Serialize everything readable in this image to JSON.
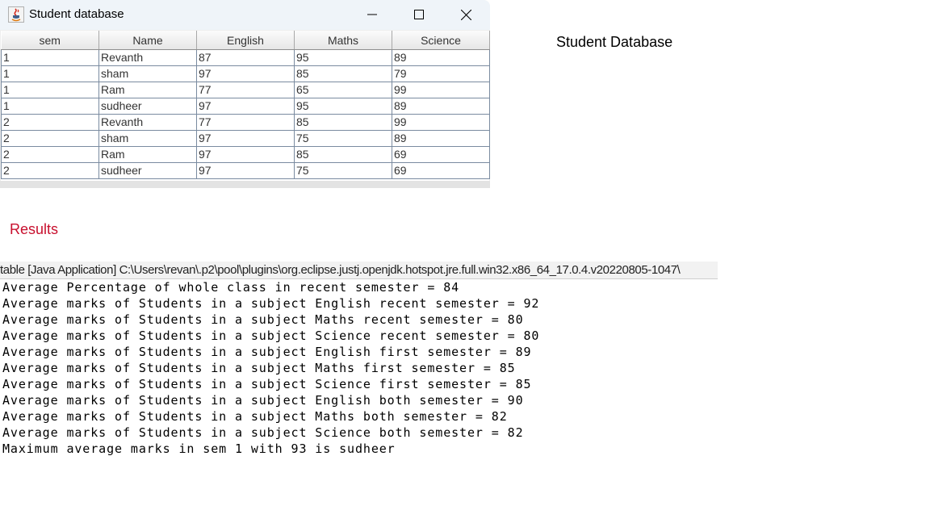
{
  "window": {
    "title": "Student database",
    "icon": "java-coffee-icon",
    "controls": [
      "minimize-icon",
      "maximize-icon",
      "close-icon"
    ]
  },
  "table": {
    "columns": [
      "sem",
      "Name",
      "English",
      "Maths",
      "Science"
    ],
    "rows": [
      [
        "1",
        "Revanth",
        "87",
        "95",
        "89"
      ],
      [
        "1",
        "sham",
        "97",
        "85",
        "79"
      ],
      [
        "1",
        "Ram",
        "77",
        "65",
        "99"
      ],
      [
        "1",
        "sudheer",
        "97",
        "95",
        "89"
      ],
      [
        "2",
        "Revanth",
        "77",
        "85",
        "99"
      ],
      [
        "2",
        "sham",
        "97",
        "75",
        "89"
      ],
      [
        "2",
        "Ram",
        "97",
        "85",
        "69"
      ],
      [
        "2",
        "sudheer",
        "97",
        "75",
        "69"
      ]
    ]
  },
  "headings": {
    "database": "Student Database",
    "results": "Results",
    "results_color": "#c8102e"
  },
  "console": {
    "header": "table [Java Application] C:\\Users\\revan\\.p2\\pool\\plugins\\org.eclipse.justj.openjdk.hotspot.jre.full.win32.x86_64_17.0.4.v20220805-1047\\",
    "lines": [
      "Average Percentage of whole class in recent semester = 84",
      "Average marks of Students in a subject English recent semester = 92",
      "Average marks of Students in a subject Maths recent semester = 80",
      "Average marks of Students in a subject Science recent semester = 80",
      "Average marks of Students in a subject English first semester = 89",
      "Average marks of Students in a subject Maths first semester = 85",
      "Average marks of Students in a subject Science first semester = 85",
      "Average marks of Students in a subject English both semester = 90",
      "Average marks of Students in a subject Maths both semester = 82",
      "Average marks of Students in a subject Science both semester = 82",
      "Maximum average marks in sem 1 with 93 is sudheer"
    ]
  }
}
